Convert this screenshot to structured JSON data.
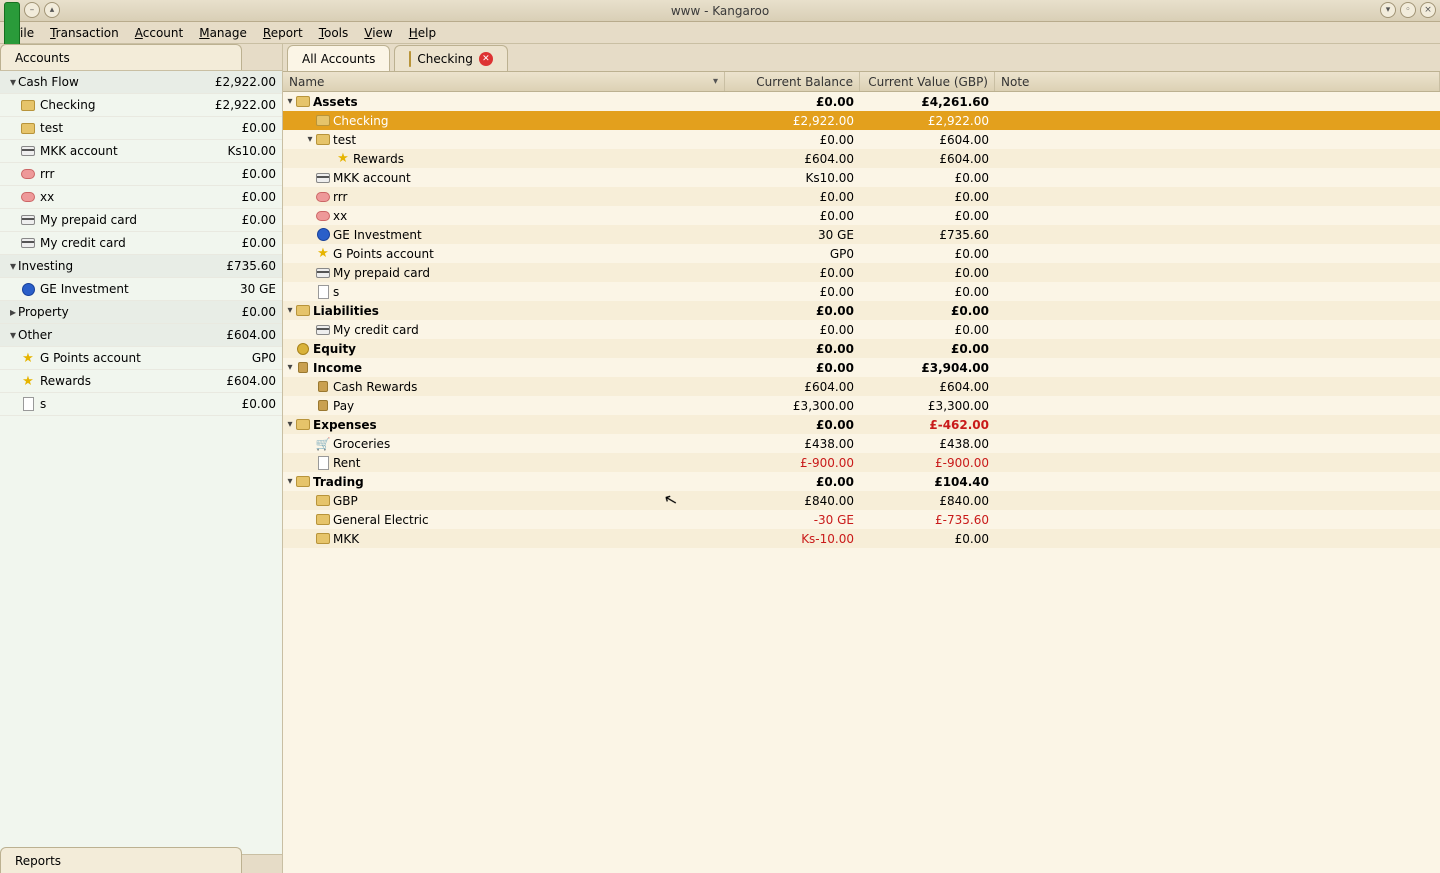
{
  "window": {
    "title": "www - Kangaroo"
  },
  "menu": [
    "File",
    "Transaction",
    "Account",
    "Manage",
    "Report",
    "Tools",
    "View",
    "Help"
  ],
  "sidebar": {
    "title": "Accounts",
    "footer": "Reports",
    "groups": [
      {
        "name": "Cash Flow",
        "value": "£2,922.00",
        "items": [
          {
            "label": "Checking",
            "value": "£2,922.00",
            "icon": "folder"
          },
          {
            "label": "test",
            "value": "£0.00",
            "icon": "folder"
          },
          {
            "label": "MKK account",
            "value": "Ks10.00",
            "icon": "card"
          },
          {
            "label": "rrr",
            "value": "£0.00",
            "icon": "pig"
          },
          {
            "label": "xx",
            "value": "£0.00",
            "icon": "pig"
          },
          {
            "label": "My prepaid card",
            "value": "£0.00",
            "icon": "card"
          },
          {
            "label": "My credit card",
            "value": "£0.00",
            "icon": "card"
          }
        ]
      },
      {
        "name": "Investing",
        "value": "£735.60",
        "items": [
          {
            "label": "GE Investment",
            "value": "30 GE",
            "icon": "ge"
          }
        ]
      },
      {
        "name": "Property",
        "value": "£0.00",
        "items": []
      },
      {
        "name": "Other",
        "value": "£604.00",
        "items": [
          {
            "label": "G Points account",
            "value": "GP0",
            "icon": "star"
          },
          {
            "label": "Rewards",
            "value": "£604.00",
            "icon": "star"
          },
          {
            "label": "s",
            "value": "£0.00",
            "icon": "doc"
          }
        ]
      }
    ]
  },
  "tabs": [
    {
      "label": "All Accounts",
      "active": true,
      "closable": false
    },
    {
      "label": "Checking",
      "active": false,
      "closable": true
    }
  ],
  "columns": {
    "name": "Name",
    "bal": "Current Balance",
    "val": "Current Value (GBP)",
    "note": "Note"
  },
  "rows": [
    {
      "indent": 0,
      "exp": true,
      "icon": "folder",
      "name": "Assets",
      "bal": "£0.00",
      "val": "£4,261.60",
      "bold": true
    },
    {
      "indent": 1,
      "icon": "folder",
      "name": "Checking",
      "bal": "£2,922.00",
      "val": "£2,922.00",
      "sel": true
    },
    {
      "indent": 1,
      "exp": true,
      "icon": "folder",
      "name": "test",
      "bal": "£0.00",
      "val": "£604.00"
    },
    {
      "indent": 2,
      "icon": "star",
      "name": "Rewards",
      "bal": "£604.00",
      "val": "£604.00"
    },
    {
      "indent": 1,
      "icon": "card",
      "name": "MKK account",
      "bal": "Ks10.00",
      "val": "£0.00"
    },
    {
      "indent": 1,
      "icon": "pig",
      "name": "rrr",
      "bal": "£0.00",
      "val": "£0.00"
    },
    {
      "indent": 1,
      "icon": "pig",
      "name": "xx",
      "bal": "£0.00",
      "val": "£0.00"
    },
    {
      "indent": 1,
      "icon": "ge",
      "name": "GE Investment",
      "bal": "30 GE",
      "val": "£735.60"
    },
    {
      "indent": 1,
      "icon": "star",
      "name": "G Points account",
      "bal": "GP0",
      "val": "£0.00"
    },
    {
      "indent": 1,
      "icon": "card",
      "name": "My prepaid card",
      "bal": "£0.00",
      "val": "£0.00"
    },
    {
      "indent": 1,
      "icon": "doc",
      "name": "s",
      "bal": "£0.00",
      "val": "£0.00"
    },
    {
      "indent": 0,
      "exp": true,
      "icon": "folder",
      "name": "Liabilities",
      "bal": "£0.00",
      "val": "£0.00",
      "bold": true
    },
    {
      "indent": 1,
      "icon": "card",
      "name": "My credit card",
      "bal": "£0.00",
      "val": "£0.00"
    },
    {
      "indent": 0,
      "icon": "money",
      "name": "Equity",
      "bal": "£0.00",
      "val": "£0.00",
      "bold": true
    },
    {
      "indent": 0,
      "exp": true,
      "icon": "bag",
      "name": "Income",
      "bal": "£0.00",
      "val": "£3,904.00",
      "bold": true
    },
    {
      "indent": 1,
      "icon": "bag",
      "name": "Cash Rewards",
      "bal": "£604.00",
      "val": "£604.00"
    },
    {
      "indent": 1,
      "icon": "bag",
      "name": "Pay",
      "bal": "£3,300.00",
      "val": "£3,300.00"
    },
    {
      "indent": 0,
      "exp": true,
      "icon": "folder",
      "name": "Expenses",
      "bal": "£0.00",
      "val": "£-462.00",
      "bold": true,
      "valneg": true
    },
    {
      "indent": 1,
      "icon": "cart",
      "name": "Groceries",
      "bal": "£438.00",
      "val": "£438.00"
    },
    {
      "indent": 1,
      "icon": "doc",
      "name": "Rent",
      "bal": "£-900.00",
      "val": "£-900.00",
      "balneg": true,
      "valneg": true
    },
    {
      "indent": 0,
      "exp": true,
      "icon": "folder",
      "name": "Trading",
      "bal": "£0.00",
      "val": "£104.40",
      "bold": true
    },
    {
      "indent": 1,
      "icon": "folder",
      "name": "GBP",
      "bal": "£840.00",
      "val": "£840.00"
    },
    {
      "indent": 1,
      "icon": "folder",
      "name": "General Electric",
      "bal": "-30 GE",
      "val": "£-735.60",
      "balneg": true,
      "valneg": true
    },
    {
      "indent": 1,
      "icon": "folder",
      "name": "MKK",
      "bal": "Ks-10.00",
      "val": "£0.00",
      "balneg": true
    }
  ]
}
